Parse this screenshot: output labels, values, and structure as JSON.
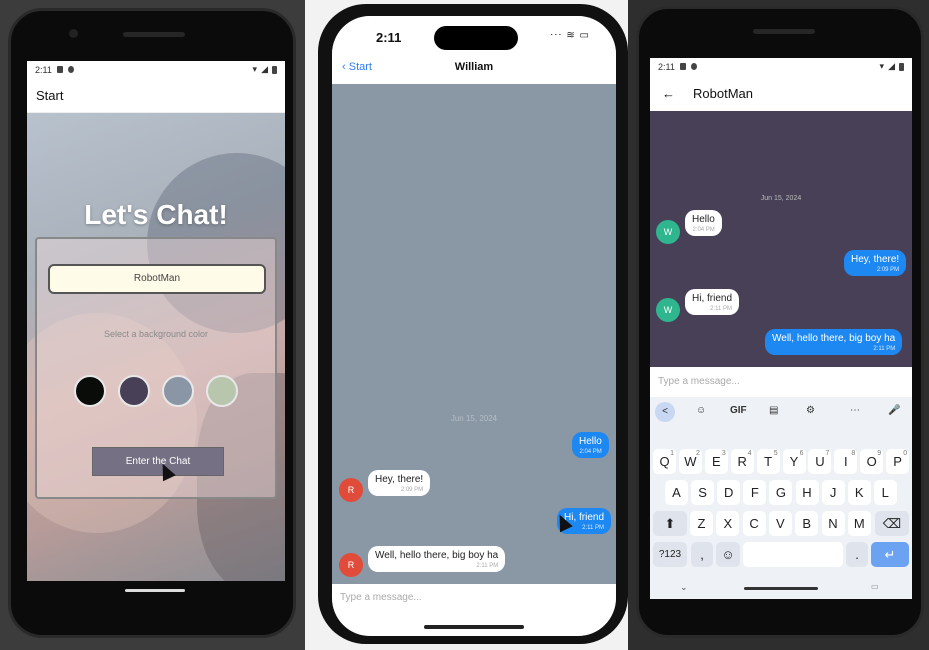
{
  "phone1": {
    "status_time": "2:11",
    "app_title": "Start",
    "hero_title": "Let's Chat!",
    "name_input_value": "RobotMan",
    "bg_color_label": "Select a background color",
    "colors": [
      "#090C08",
      "#474056",
      "#8A95A5",
      "#B9C6AE"
    ],
    "enter_button": "Enter the Chat"
  },
  "phone2": {
    "status_time": "2:11",
    "back_label": "Start",
    "chat_title": "William",
    "date_label": "Jun 15, 2024",
    "messages": [
      {
        "text": "Hello",
        "time": "2:04 PM",
        "dir": "out"
      },
      {
        "text": "Hey, there!",
        "time": "2:09 PM",
        "dir": "in",
        "avatar": "R"
      },
      {
        "text": "Hi, friend",
        "time": "2:11 PM",
        "dir": "out"
      },
      {
        "text": "Well, hello there, big boy ha",
        "time": "2:11 PM",
        "dir": "in",
        "avatar": "R"
      }
    ],
    "composer_placeholder": "Type a message..."
  },
  "phone3": {
    "status_time": "2:11",
    "chat_title": "RobotMan",
    "date_label": "Jun 15, 2024",
    "messages": [
      {
        "text": "Hello",
        "time": "2:04 PM",
        "dir": "in",
        "avatar": "W"
      },
      {
        "text": "Hey, there!",
        "time": "2:09 PM",
        "dir": "out"
      },
      {
        "text": "Hi, friend",
        "time": "2:11 PM",
        "dir": "in",
        "avatar": "W"
      },
      {
        "text": "Well, hello there, big boy ha",
        "time": "2:11 PM",
        "dir": "out"
      }
    ],
    "composer_placeholder": "Type a message...",
    "keyboard": {
      "toolbar": [
        "<",
        "☺",
        "GIF",
        "▤",
        "⚙",
        "⋯",
        "🎤"
      ],
      "row1": [
        "Q",
        "W",
        "E",
        "R",
        "T",
        "Y",
        "U",
        "I",
        "O",
        "P"
      ],
      "row1_hints": [
        "1",
        "2",
        "3",
        "4",
        "5",
        "6",
        "7",
        "8",
        "9",
        "0"
      ],
      "row2": [
        "A",
        "S",
        "D",
        "F",
        "G",
        "H",
        "J",
        "K",
        "L"
      ],
      "row3": [
        "Z",
        "X",
        "C",
        "V",
        "B",
        "N",
        "M"
      ],
      "sym_key": "?123",
      "comma": ",",
      "period": "."
    }
  }
}
